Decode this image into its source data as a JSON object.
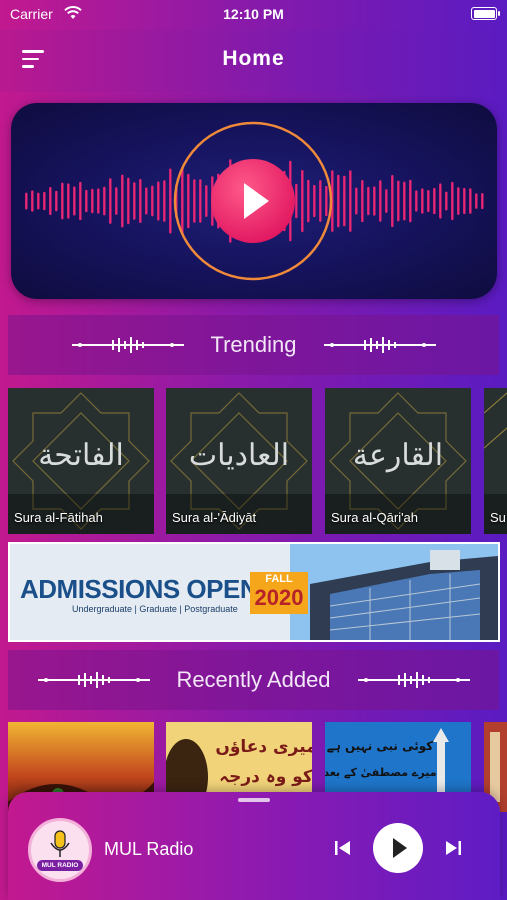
{
  "status_bar": {
    "carrier": "Carrier",
    "time": "12:10 PM"
  },
  "nav": {
    "title": "Home",
    "menu_icon": "menu-icon"
  },
  "hero": {
    "play_icon": "play-icon",
    "accent": "#f0457a"
  },
  "sections": {
    "trending": "Trending",
    "recent": "Recently Added"
  },
  "trending": [
    {
      "arabic": "الفاتحة",
      "caption": "Sura al-Fātihah"
    },
    {
      "arabic": "العاديات",
      "caption": "Sura al-'Ādiyāt"
    },
    {
      "arabic": "القارعة",
      "caption": "Sura al-Qāri'ah"
    },
    {
      "arabic": "",
      "caption": "Su"
    }
  ],
  "ad": {
    "line1": "ADMISSIONS OPEN",
    "fall": "FALL",
    "year": "2020",
    "line2": "Undergraduate | Graduate | Postgraduate"
  },
  "recent": [
    {
      "text": "",
      "bg": "#a0381c"
    },
    {
      "text": "میری دعاؤں\nکو وہ درجہ",
      "bg": "#f1d37a"
    },
    {
      "text": "کوئی نبی نہیں ہے\nمیرے مصطفیٰ ﷺ کے بعد",
      "bg": "#1f75c9"
    },
    {
      "text": "",
      "bg": "#b23e2e"
    }
  ],
  "mini_player": {
    "title": "MUL Radio",
    "logo_text": "MUL RADIO",
    "prev_icon": "skip-previous-icon",
    "play_icon": "play-icon",
    "next_icon": "skip-next-icon"
  }
}
